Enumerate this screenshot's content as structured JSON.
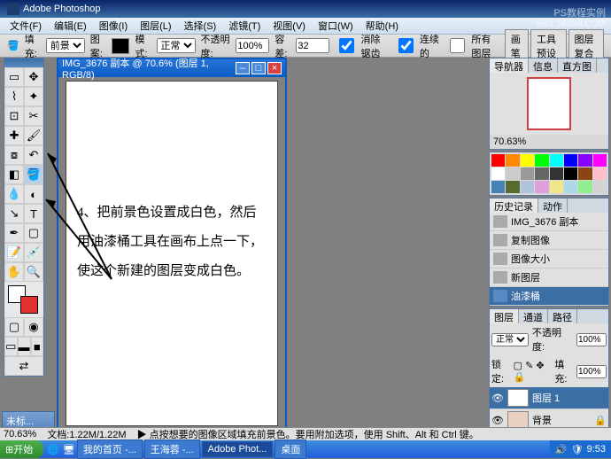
{
  "title_bar": {
    "app": "Adobe Photoshop"
  },
  "watermark": {
    "line1": "PS教程实例",
    "line2": "BBS.16XX8.COM"
  },
  "menu": [
    "文件(F)",
    "编辑(E)",
    "图像(I)",
    "图层(L)",
    "选择(S)",
    "滤镜(T)",
    "视图(V)",
    "窗口(W)",
    "帮助(H)"
  ],
  "options": {
    "fill_label": "填充:",
    "fill_value": "前景",
    "pattern_label": "图案:",
    "mode_label": "模式:",
    "mode_value": "正常",
    "opacity_label": "不透明度:",
    "opacity_value": "100%",
    "tolerance_label": "容差:",
    "tolerance_value": "32",
    "antialias": "消除锯齿",
    "contiguous": "连续的",
    "all_layers": "所有图层",
    "btn1": "画笔",
    "btn2": "工具预设",
    "btn3": "图层复合"
  },
  "doc": {
    "title": "IMG_3676 副本 @ 70.6% (图层 1, RGB/8)"
  },
  "annotation": "4、把前景色设置成白色，然后用油漆桶工具在画布上点一下，使这个新建的图层变成白色。",
  "navigator": {
    "tabs": [
      "导航器",
      "信息",
      "直方图"
    ],
    "zoom": "70.63%"
  },
  "swatches": [
    "#ff0000",
    "#ff8800",
    "#ffff00",
    "#00ff00",
    "#00ffff",
    "#0000ff",
    "#8800ff",
    "#ff00ff",
    "#ffffff",
    "#cccccc",
    "#999999",
    "#666666",
    "#333333",
    "#000000",
    "#8b4513",
    "#ffc0cb",
    "#4682b4",
    "#556b2f",
    "#b0c4de",
    "#dda0dd",
    "#f0e68c",
    "#add8e6",
    "#90ee90",
    "#d3d3d3"
  ],
  "history": {
    "tabs": [
      "历史记录",
      "动作"
    ],
    "doc_name": "IMG_3676 副本",
    "items": [
      "复制图像",
      "图像大小",
      "新图层",
      "油漆桶"
    ]
  },
  "layers": {
    "tabs": [
      "图层",
      "通道",
      "路径"
    ],
    "mode": "正常",
    "opacity_label": "不透明度:",
    "opacity_value": "100%",
    "lock_label": "锁定:",
    "fill_label": "填充:",
    "fill_value": "100%",
    "items": [
      {
        "name": "图层 1",
        "selected": true
      },
      {
        "name": "背景",
        "selected": false
      }
    ]
  },
  "status": {
    "zoom": "70.63%",
    "doc_info": "文档:1.22M/1.22M",
    "hint": "▶ 点按想要的图像区域填充前景色。要用附加选项，使用 Shift、Alt 和 Ctrl 键。"
  },
  "taskbar": {
    "start": "开始",
    "tasks": [
      "我的首页 -...",
      "王海蓉 -...",
      "Adobe Phot...",
      "桌面"
    ],
    "time": "9:53"
  },
  "hidden_win": "未标..."
}
